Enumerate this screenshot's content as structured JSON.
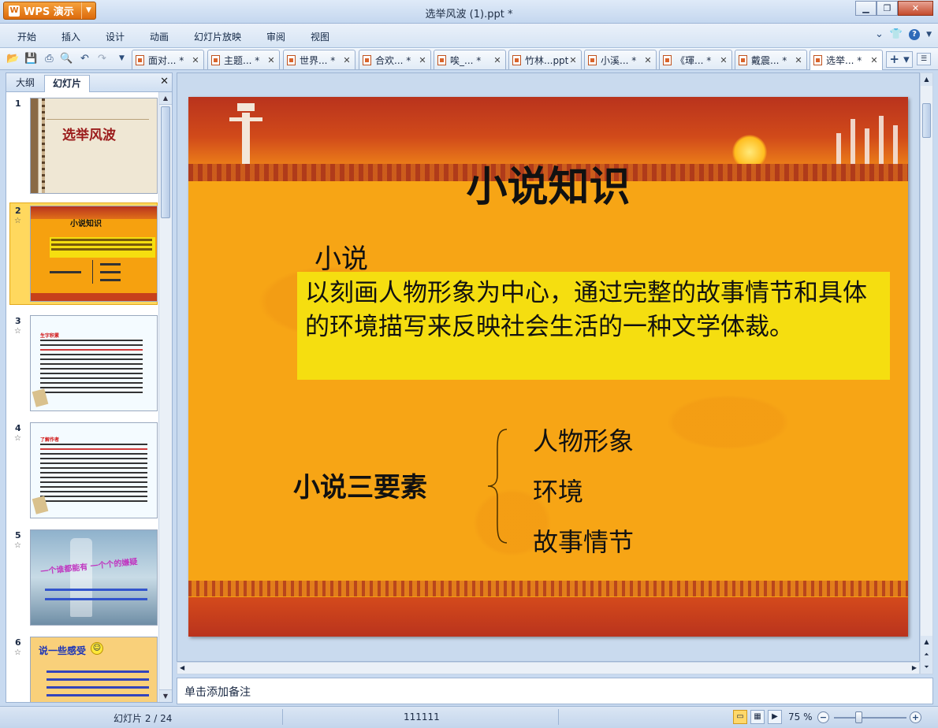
{
  "app": {
    "name": "WPS 演示",
    "logo_letter": "W",
    "window_title": "选举风波 (1).ppt *"
  },
  "menu": [
    "开始",
    "插入",
    "设计",
    "动画",
    "幻灯片放映",
    "审阅",
    "视图"
  ],
  "tabs": [
    {
      "label": "面对... *",
      "active": false
    },
    {
      "label": "主题... *",
      "active": false
    },
    {
      "label": "世界... *",
      "active": false
    },
    {
      "label": "合欢... *",
      "active": false
    },
    {
      "label": "唉_... *",
      "active": false
    },
    {
      "label": "竹林...ppt",
      "active": false
    },
    {
      "label": "小溪... *",
      "active": false
    },
    {
      "label": "《琿... *",
      "active": false
    },
    {
      "label": "戴震... *",
      "active": false
    },
    {
      "label": "选举... *",
      "active": true
    }
  ],
  "left_pane": {
    "tabs": [
      "大纲",
      "幻灯片"
    ],
    "active_tab": "幻灯片",
    "thumbnails": [
      {
        "num": "1",
        "title": "选举风波"
      },
      {
        "num": "2",
        "title": "小说知识",
        "selected": true
      },
      {
        "num": "3",
        "title": "生字积累"
      },
      {
        "num": "4",
        "title": "了解作者"
      },
      {
        "num": "5",
        "title": "一个谁都能有 一个个的嫌疑"
      },
      {
        "num": "6",
        "title": "说一些感受"
      }
    ]
  },
  "slide": {
    "title": "小说知识",
    "subtitle": "小说",
    "definition": "以刻画人物形象为中心，通过完整的故事情节和具体的环境描写来反映社会生活的一种文学体裁。",
    "elements_title": "小说三要素",
    "elements": [
      "人物形象",
      "环境",
      "故事情节"
    ]
  },
  "notes": {
    "placeholder": "单击添加备注"
  },
  "status": {
    "slide_position": "幻灯片 2 / 24",
    "template_name": "111111",
    "zoom": "75 %",
    "zoom_percent": 75
  },
  "colors": {
    "slide_background": "#f6a10f",
    "definition_highlight": "#f5de10",
    "title_bar_button": "#dc6a0c"
  }
}
